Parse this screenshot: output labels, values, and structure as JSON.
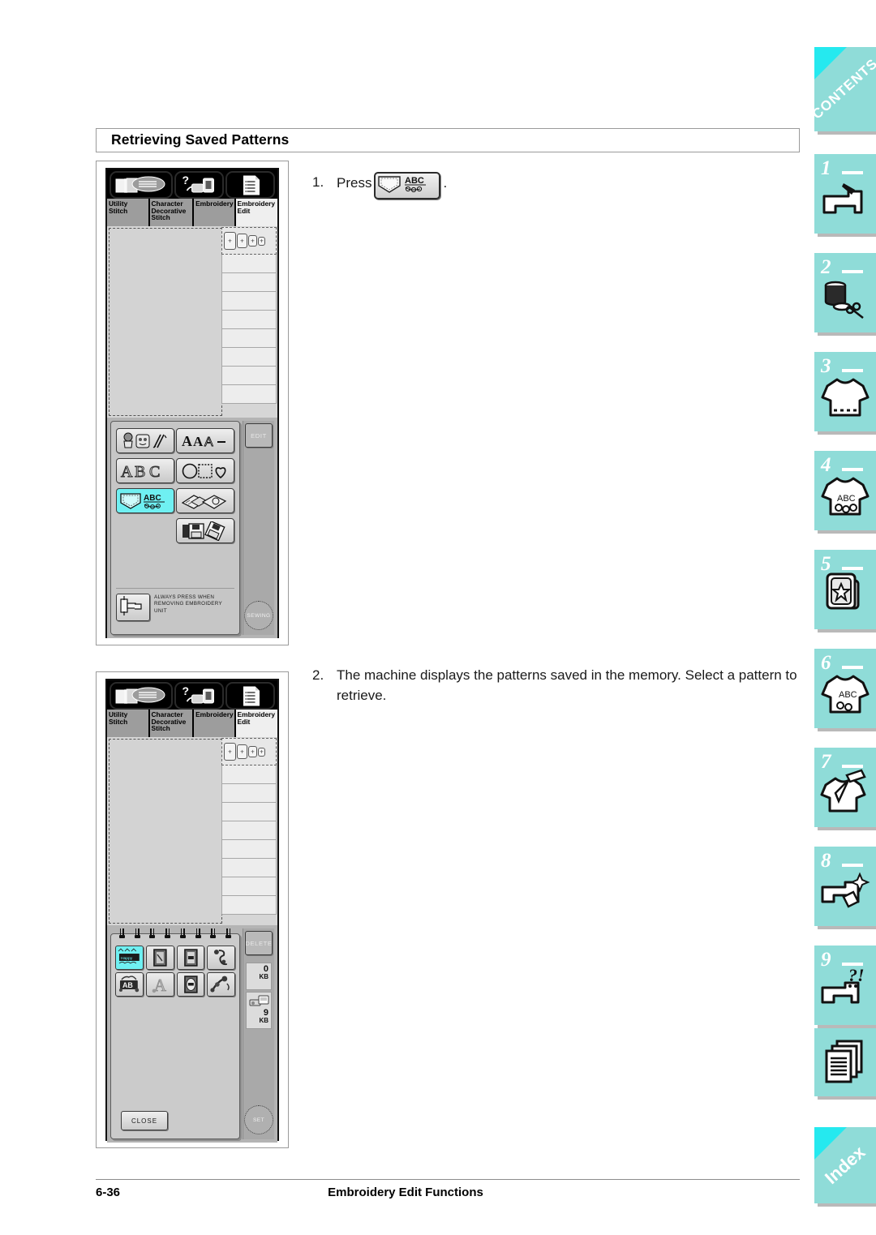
{
  "document": {
    "section_title": "Retrieving Saved Patterns",
    "footer_page": "6-36",
    "footer_title": "Embroidery Edit Functions"
  },
  "steps": [
    {
      "number": "1.",
      "text_before": "Press",
      "text_after": ".",
      "button_icon": "pocket-abc-icon"
    },
    {
      "number": "2.",
      "text": "The machine displays the patterns saved in the memory. Select a pattern to retrieve."
    }
  ],
  "machine_screen": {
    "tab_icons": [
      "manual-book-icon",
      "help-machine-icon",
      "settings-list-icon"
    ],
    "tabs": [
      {
        "label": "Utility Stitch",
        "line1": "Utility",
        "line2": "Stitch",
        "active": false
      },
      {
        "label": "Character Decorative Stitch",
        "line1": "Character",
        "line2": "Decorative",
        "line3": "Stitch",
        "active": false
      },
      {
        "label": "Embroidery",
        "line1": "Embroidery",
        "active": false
      },
      {
        "label": "Embroidery Edit",
        "line1": "Embroidery",
        "line2": "Edit",
        "active": true
      }
    ],
    "hoop_sizes": [
      "+",
      "+",
      "+",
      "+"
    ],
    "list_rows": 8
  },
  "screen_one": {
    "selector_buttons": [
      {
        "name": "embroidery-patterns-button",
        "icon": "flower-bag-scissors-icon",
        "selected": false
      },
      {
        "name": "font-patterns-button",
        "icon": "aaa-icon",
        "label": "AAA",
        "selected": false
      },
      {
        "name": "alphabet-patterns-button",
        "icon": "abc-outline-icon",
        "label": "ABC",
        "selected": false
      },
      {
        "name": "frame-patterns-button",
        "icon": "circle-square-heart-icon",
        "selected": false
      },
      {
        "name": "saved-patterns-button",
        "icon": "pocket-abc-icon",
        "label": "ABC",
        "selected": true
      },
      {
        "name": "card-patterns-button",
        "icon": "embroidery-cards-icon",
        "selected": false
      },
      {
        "name": "floppy-patterns-button",
        "icon": "floppy-disk-icon",
        "selected": false
      }
    ],
    "note": {
      "icon": "carriage-return-icon",
      "line1": "ALWAYS PRESS WHEN",
      "line2": "REMOVING EMBROIDERY",
      "line3": "UNIT"
    },
    "rail": {
      "top_button": "EDIT",
      "bottom_button": "SEWING"
    }
  },
  "screen_two": {
    "saved_patterns": [
      {
        "name": "pattern-happy-birthday",
        "label": "Happy Birthday",
        "selected": true
      },
      {
        "name": "pattern-frame-2",
        "label": "",
        "selected": false
      },
      {
        "name": "pattern-frame-3",
        "label": "",
        "selected": false
      },
      {
        "name": "pattern-flourish-4",
        "label": "",
        "selected": false
      },
      {
        "name": "pattern-ab",
        "label": "AB",
        "selected": false
      },
      {
        "name": "pattern-letter-a",
        "label": "A",
        "selected": false
      },
      {
        "name": "pattern-oval-frame",
        "label": "",
        "selected": false
      },
      {
        "name": "pattern-floral",
        "label": "",
        "selected": false
      }
    ],
    "close_label": "CLOSE",
    "rail": {
      "top_button": "DELETE",
      "memory_free_value": "0",
      "memory_free_unit": "KB",
      "memory_used_icon": "memory-card-icon",
      "memory_used_value": "9",
      "memory_used_unit": "KB",
      "bottom_button": "SET"
    }
  },
  "sidebar": {
    "tabs": [
      {
        "name": "sidebar-tab-contents",
        "label": "CONTENTS",
        "type": "text",
        "number": ""
      },
      {
        "name": "sidebar-tab-1",
        "number": "1",
        "icon": "sewing-machine-needle-icon",
        "type": "icon"
      },
      {
        "name": "sidebar-tab-2",
        "number": "2",
        "icon": "thread-spool-scissors-icon",
        "type": "icon"
      },
      {
        "name": "sidebar-tab-3",
        "number": "3",
        "icon": "tshirt-stitch-icon",
        "type": "icon"
      },
      {
        "name": "sidebar-tab-4",
        "number": "4",
        "icon": "tshirt-abc-icon",
        "type": "icon"
      },
      {
        "name": "sidebar-tab-5",
        "number": "5",
        "icon": "hoop-star-icon",
        "type": "icon"
      },
      {
        "name": "sidebar-tab-6",
        "number": "6",
        "icon": "tshirt-abc-edit-icon",
        "type": "icon"
      },
      {
        "name": "sidebar-tab-7",
        "number": "7",
        "icon": "tshirt-pencil-icon",
        "type": "icon"
      },
      {
        "name": "sidebar-tab-8",
        "number": "8",
        "icon": "machine-sparkle-icon",
        "type": "icon"
      },
      {
        "name": "sidebar-tab-9",
        "number": "9",
        "icon": "machine-question-icon",
        "type": "icon"
      },
      {
        "name": "sidebar-tab-appendix",
        "number": "",
        "icon": "documents-stack-icon",
        "type": "icon"
      },
      {
        "name": "sidebar-tab-index",
        "label": "Index",
        "type": "text",
        "number": ""
      }
    ]
  },
  "colors": {
    "tab_teal": "#8fdcd8",
    "tab_corner": "#25e9ef",
    "selected_cyan": "#6ff0f2",
    "lcd_gray": "#b4b4b4"
  }
}
